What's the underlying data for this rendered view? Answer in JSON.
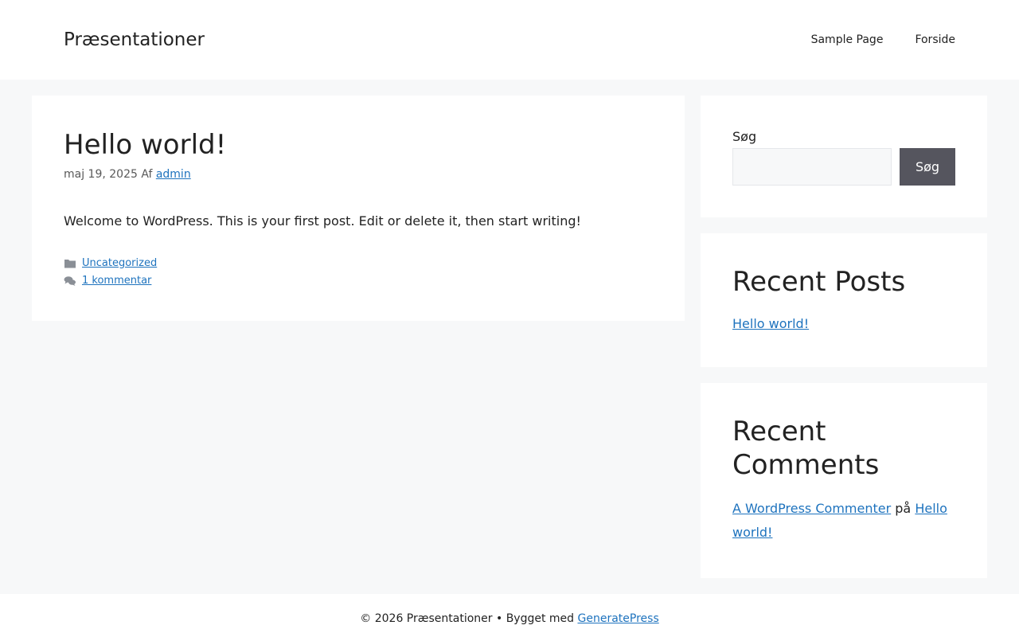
{
  "header": {
    "site_title": "Præsentationer",
    "nav": [
      "Sample Page",
      "Forside"
    ]
  },
  "post": {
    "title": "Hello world!",
    "date": "maj 19, 2025",
    "author_prefix": "Af",
    "author": "admin",
    "content": "Welcome to WordPress. This is your first post. Edit or delete it, then start writing!",
    "category": "Uncategorized",
    "comments_link": "1 kommentar"
  },
  "sidebar": {
    "search": {
      "label": "Søg",
      "value": "",
      "button_label": "Søg"
    },
    "recent_posts": {
      "title": "Recent Posts",
      "items": [
        "Hello world!"
      ]
    },
    "recent_comments": {
      "title": "Recent Comments",
      "commenter": "A WordPress Commenter",
      "connector": "på",
      "post_link": "Hello world!"
    }
  },
  "footer": {
    "text": "© 2026 Præsentationer • Bygget med",
    "link": "GeneratePress"
  },
  "icons": {
    "category": "folder-icon",
    "comments": "comments-icon"
  },
  "colors": {
    "link": "#1e73be",
    "button_bg": "#55555e",
    "page_bg": "#f7f8f9"
  }
}
